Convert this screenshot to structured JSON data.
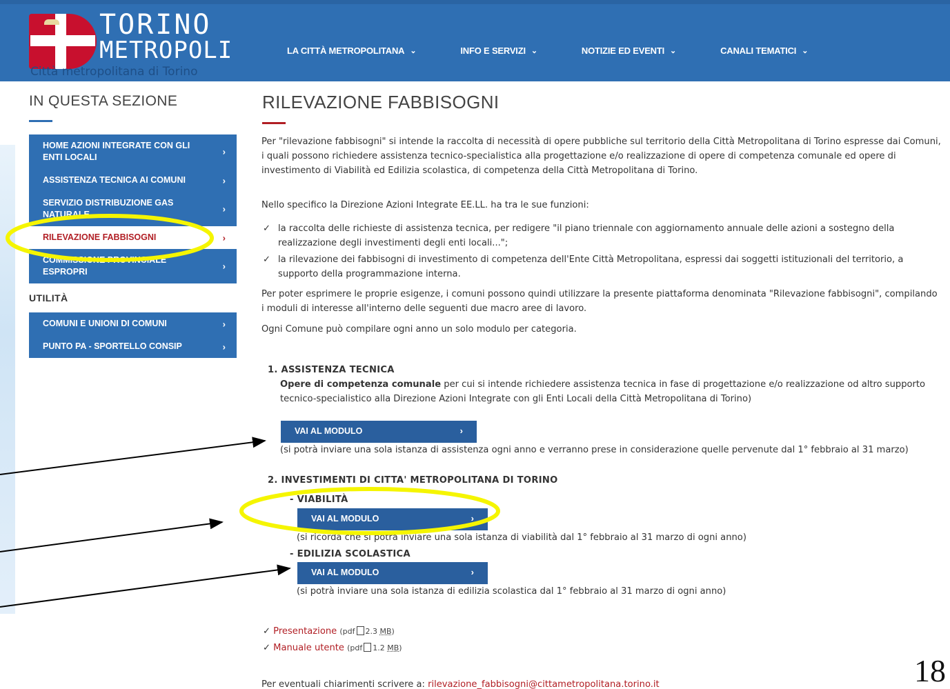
{
  "header": {
    "logo_word1": "TORINO",
    "logo_word2": "METROPOLI",
    "logo_subtitle": "Città metropolitana di Torino",
    "nav": [
      {
        "label": "LA CITTÀ METROPOLITANA"
      },
      {
        "label": "INFO E SERVIZI"
      },
      {
        "label": "NOTIZIE ED EVENTI"
      },
      {
        "label": "CANALI TEMATICI"
      }
    ]
  },
  "sidebar": {
    "title": "IN QUESTA SEZIONE",
    "items": [
      {
        "label": "HOME AZIONI INTEGRATE CON GLI ENTI LOCALI"
      },
      {
        "label": "ASSISTENZA TECNICA AI COMUNI"
      },
      {
        "label": "SERVIZIO DISTRIBUZIONE GAS NATURALE"
      },
      {
        "label": "RILEVAZIONE FABBISOGNI"
      },
      {
        "label": "COMMISSIONE PROVINCIALE ESPROPRI"
      }
    ],
    "util_title": "UTILITÀ",
    "util_items": [
      {
        "label": "COMUNI E UNIONI DI COMUNI"
      },
      {
        "label": "PUNTO PA - SPORTELLO CONSIP"
      }
    ]
  },
  "main": {
    "title": "RILEVAZIONE FABBISOGNI",
    "p1": "Per \"rilevazione fabbisogni\" si intende la raccolta di necessità di opere pubbliche sul territorio della Città Metropolitana di Torino espresse dai Comuni, i quali possono richiedere assistenza tecnico-specialistica alla progettazione e/o realizzazione di opere di competenza comunale ed opere di investimento di Viabilità ed Edilizia scolastica, di competenza della Città Metropolitana di Torino.",
    "p2": "Nello specifico la Direzione Azioni Integrate EE.LL. ha tra le sue funzioni:",
    "bullets": [
      "la raccolta delle richieste di assistenza tecnica, per redigere \"il piano triennale con aggiornamento annuale delle azioni a sostegno della realizzazione degli investimenti degli enti locali...\";",
      "la rilevazione dei fabbisogni di investimento di competenza dell'Ente Città Metropolitana, espressi dai soggetti istituzionali del territorio, a supporto della programmazione interna."
    ],
    "p3": "Per poter esprimere le proprie esigenze, i comuni possono quindi utilizzare la presente piattaforma denominata \"Rilevazione fabbisogni\", compilando i moduli di interesse all'interno delle seguenti due macro aree di lavoro.",
    "p4": "Ogni Comune può compilare ogni anno un solo modulo per categoria.",
    "sec1_head": "1. ASSISTENZA TECNICA",
    "sec1_bold": "Opere di competenza comunale",
    "sec1_text": " per cui si intende richiedere assistenza tecnica in fase di progettazione e/o realizzazione od altro supporto tecnico-specialistico alla Direzione Azioni Integrate con gli Enti Locali della Città Metropolitana di Torino)",
    "btn_label": "VAI AL MODULO",
    "sec1_note": "(si potrà inviare una sola istanza di assistenza ogni anno e verranno prese in considerazione quelle pervenute dal 1° febbraio al 31 marzo)",
    "sec2_head": "2. INVESTIMENTI DI CITTA' METROPOLITANA DI TORINO",
    "sub1_head": "- VIABILITÀ",
    "sub1_note": "(si ricorda che si potrà inviare una sola istanza di viabilità dal 1° febbraio al 31 marzo di ogni anno)",
    "sub2_head": "- EDILIZIA SCOLASTICA",
    "sub2_note": "(si potrà inviare una sola istanza di edilizia scolastica dal 1° febbraio al 31 marzo di ogni anno)",
    "files": [
      {
        "label": "Presentazione",
        "type": "pdf",
        "size": "2.3",
        "unit": "MB"
      },
      {
        "label": "Manuale utente",
        "type": "pdf",
        "size": "1.2",
        "unit": "MB"
      }
    ],
    "contact_prefix": "Per eventuali chiarimenti scrivere a: ",
    "contact_email": "rilevazione_fabbisogni@cittametropolitana.torino.it"
  },
  "page_number": "18",
  "colors": {
    "header_blue": "#2f6fb3",
    "button_blue": "#2a5f9e",
    "accent_red": "#b11e24",
    "highlight_yellow": "#f5f500"
  }
}
